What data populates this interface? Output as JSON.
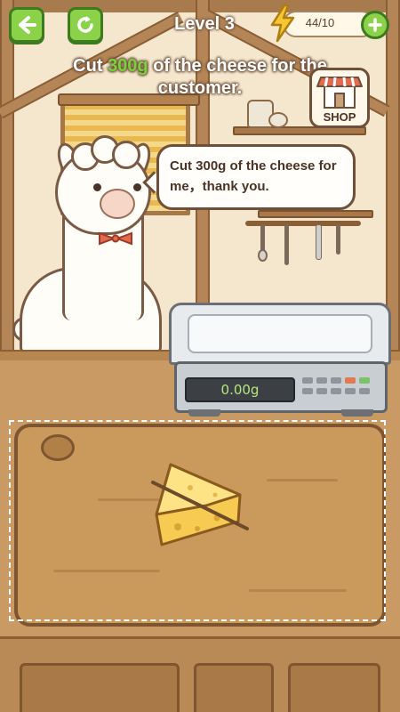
{
  "hud": {
    "level_label": "Level 3",
    "energy": "44/10"
  },
  "task": {
    "prefix": "Cut",
    "amount": "300g",
    "suffix": "of the cheese for the",
    "line2": "customer."
  },
  "shop": {
    "label": "SHOP"
  },
  "customer": {
    "speech": "Cut 300g of the cheese for me，thank you."
  },
  "scale": {
    "reading": "0.00g"
  },
  "icons": {
    "back": "arrow-left-icon",
    "restart": "restart-icon",
    "energy": "lightning-bolt-icon",
    "add": "plus-icon",
    "shop": "shop-icon"
  },
  "colors": {
    "button_green": "#8bd248",
    "highlight_green": "#7bd13b",
    "energy_yellow": "#f7c634"
  }
}
